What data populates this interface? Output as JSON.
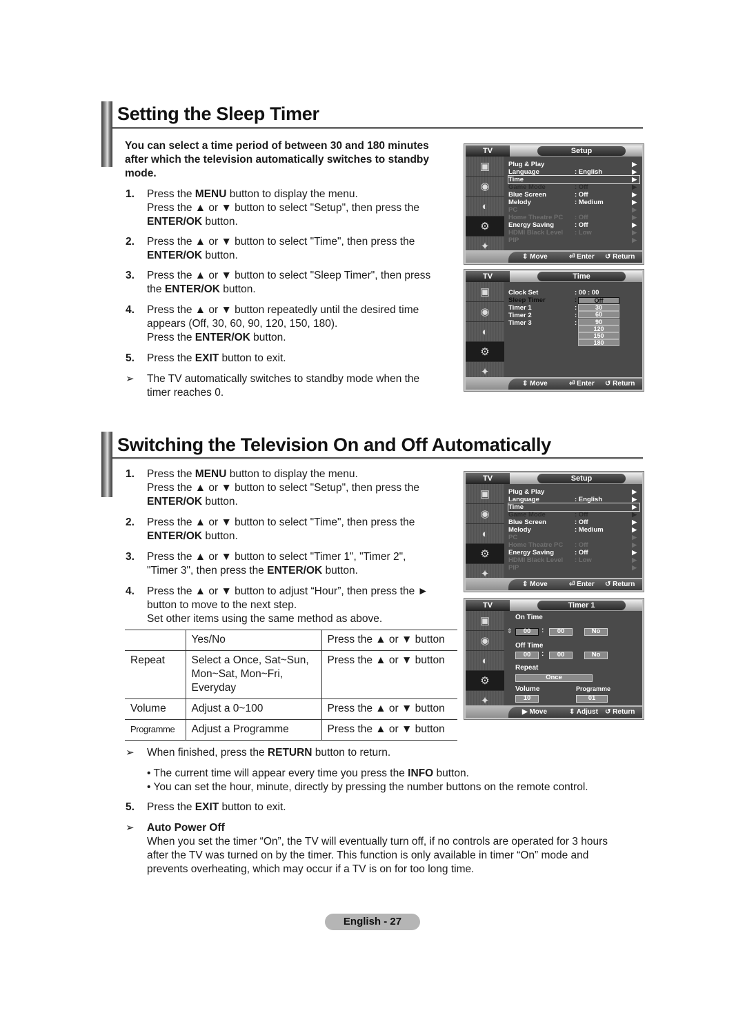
{
  "section1": {
    "title": "Setting the Sleep Timer",
    "intro": "You can select a time period of between 30 and 180 minutes after which the television automatically switches to standby mode.",
    "steps": [
      {
        "num": "1.",
        "lines": [
          [
            "Press the ",
            "MENU",
            " button to display the menu."
          ],
          [
            "Press the ▲ or ▼ button to select \"Setup\", then press the"
          ],
          [
            "",
            "ENTER/OK",
            " button."
          ]
        ]
      },
      {
        "num": "2.",
        "lines": [
          [
            "Press the ▲ or ▼ button to select \"Time\", then press the"
          ],
          [
            "",
            "ENTER/OK",
            " button."
          ]
        ]
      },
      {
        "num": "3.",
        "lines": [
          [
            "Press the ▲ or ▼ button to select \"Sleep Timer\", then press"
          ],
          [
            "the ",
            "ENTER/OK",
            " button."
          ]
        ]
      },
      {
        "num": "4.",
        "lines": [
          [
            "Press the ▲ or ▼ button repeatedly until the desired time"
          ],
          [
            "appears (Off, 30, 60, 90, 120, 150, 180)."
          ],
          [
            "Press the ",
            "ENTER/OK",
            " button."
          ]
        ]
      },
      {
        "num": "5.",
        "lines": [
          [
            "Press the ",
            "EXIT",
            " button to exit."
          ]
        ]
      }
    ],
    "note": [
      "The TV automatically switches to standby mode when the",
      "timer reaches 0."
    ]
  },
  "section2": {
    "title": "Switching the Television On and Off Automatically",
    "steps": [
      {
        "num": "1.",
        "lines": [
          [
            "Press the ",
            "MENU",
            " button to display the menu."
          ],
          [
            "Press the ▲ or ▼ button to select \"Setup\", then press the"
          ],
          [
            "",
            "ENTER/OK",
            " button."
          ]
        ]
      },
      {
        "num": "2.",
        "lines": [
          [
            "Press the ▲ or ▼ button to select \"Time\", then press the"
          ],
          [
            "",
            "ENTER/OK",
            " button."
          ]
        ]
      },
      {
        "num": "3.",
        "lines": [
          [
            "Press the ▲ or ▼ button to select \"Timer 1\", \"Timer 2\","
          ],
          [
            "\"Timer 3\", then press the ",
            "ENTER/OK",
            " button."
          ]
        ]
      },
      {
        "num": "4.",
        "lines": [
          [
            "Press the ▲ or ▼ button to adjust “Hour”, then press the ►"
          ],
          [
            "button to move to the next step."
          ],
          [
            "Set other items using the same method as above."
          ]
        ]
      }
    ],
    "table": [
      [
        "",
        "Yes/No",
        "Press the ▲ or ▼ button"
      ],
      [
        "Repeat",
        "Select a Once, Sat~Sun, Mon~Sat, Mon~Fri, Everyday",
        "Press the ▲ or ▼ button"
      ],
      [
        "Volume",
        "Adjust a 0~100",
        "Press the ▲ or ▼ button"
      ],
      [
        "Programme",
        "Adjust a Programme",
        "Press the ▲ or ▼ button"
      ]
    ],
    "return_note": [
      "When finished, press the ",
      "RETURN",
      " button to return."
    ],
    "bullets": [
      [
        "• The current time will appear every time you press the ",
        "INFO",
        " button."
      ],
      [
        "• You can set the hour, minute, directly by pressing the number buttons on the remote control."
      ]
    ],
    "step5": {
      "num": "5.",
      "lines": [
        [
          "Press the ",
          "EXIT",
          " button to exit."
        ]
      ]
    },
    "auto_power_off": {
      "heading": "Auto Power Off",
      "lines": [
        "When you set the timer “On”, the TV will eventually turn off, if no controls are operated for 3 hours",
        "after the TV was turned on by the timer. This function is only available in timer “On” mode and",
        "prevents overheating, which may occur if a TV is on for too long time."
      ]
    }
  },
  "osd_setup": {
    "tv_label": "TV",
    "title": "Setup",
    "items": [
      {
        "label": "Plug & Play",
        "value": "",
        "state": "normal"
      },
      {
        "label": "Language",
        "value": ": English",
        "state": "normal"
      },
      {
        "label": "Time",
        "value": "",
        "state": "selected"
      },
      {
        "label": "Game Mode",
        "value": ": Off",
        "state": "hidden"
      },
      {
        "label": "Blue Screen",
        "value": ": Off",
        "state": "normal"
      },
      {
        "label": "Melody",
        "value": ": Medium",
        "state": "normal"
      },
      {
        "label": "PC",
        "value": "",
        "state": "dim"
      },
      {
        "label": "Home Theatre PC",
        "value": ": Off",
        "state": "dim"
      },
      {
        "label": "Energy Saving",
        "value": ": Off",
        "state": "normal"
      },
      {
        "label": "HDMI Black Level",
        "value": ": Low",
        "state": "dim"
      },
      {
        "label": "PIP",
        "value": "",
        "state": "dim"
      }
    ],
    "footer": {
      "move": "Move",
      "enter": "Enter",
      "return": "Return"
    }
  },
  "osd_time": {
    "tv_label": "TV",
    "title": "Time",
    "items": [
      {
        "label": "Clock Set",
        "value": ": 00 : 00"
      },
      {
        "label": "Sleep Timer",
        "value": ":"
      },
      {
        "label": "Timer 1",
        "value": ":"
      },
      {
        "label": "Timer 2",
        "value": ":"
      },
      {
        "label": "Timer 3",
        "value": ":"
      }
    ],
    "sleep_options": [
      "Off",
      "30",
      "60",
      "90",
      "120",
      "150",
      "180"
    ],
    "sleep_selected": "Off",
    "footer": {
      "move": "Move",
      "enter": "Enter",
      "return": "Return"
    }
  },
  "osd_timer1": {
    "tv_label": "TV",
    "title": "Timer 1",
    "on_time_label": "On Time",
    "on_hour": "00",
    "on_minute": "00",
    "on_enable": "No",
    "off_time_label": "Off Time",
    "off_hour": "00",
    "off_minute": "00",
    "off_enable": "No",
    "repeat_label": "Repeat",
    "repeat_value": "Once",
    "volume_label": "Volume",
    "volume_value": "10",
    "programme_label": "Programme",
    "programme_value": "01",
    "footer": {
      "move": "Move",
      "adjust": "Adjust",
      "return": "Return"
    }
  },
  "page_label": "English - 27"
}
